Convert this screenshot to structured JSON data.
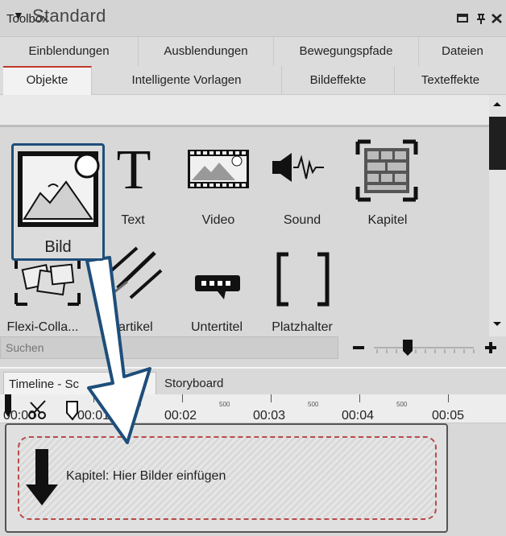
{
  "window": {
    "title": "Toolbox",
    "controls": [
      "minimize-icon",
      "pin-icon",
      "close-icon"
    ]
  },
  "tabs_row1": [
    "Einblendungen",
    "Ausblendungen",
    "Bewegungspfade",
    "Dateien"
  ],
  "tabs_row2": [
    "Objekte",
    "Intelligente Vorlagen",
    "Bildeffekte",
    "Texteffekte"
  ],
  "active_tab": "Objekte",
  "section": {
    "label": "Standard"
  },
  "objects": {
    "row1": [
      "Bild",
      "Text",
      "Video",
      "Sound",
      "Kapitel"
    ],
    "row2": [
      "Flexi-Colla...",
      "Partikel",
      "Untertitel",
      "Platzhalter"
    ]
  },
  "search": {
    "placeholder": "Suchen"
  },
  "bottom_tabs": [
    "Timeline - Standardansicht",
    "Storyboard"
  ],
  "bottom_tab_visible": {
    "timeline": "Timeline - Sc",
    "timeline_tail": "nt"
  },
  "ruler": {
    "labels": [
      "00:00",
      "00:01",
      "00:02",
      "00:03",
      "00:04",
      "00:05"
    ],
    "half": "500"
  },
  "timeline": {
    "chapter_text": "Kapitel: Hier Bilder einfügen"
  },
  "colors": {
    "accent": "#c0392b",
    "popup_border": "#1e4e7a",
    "arrow_fill": "#ffffff",
    "arrow_stroke": "#1e4e7a"
  }
}
